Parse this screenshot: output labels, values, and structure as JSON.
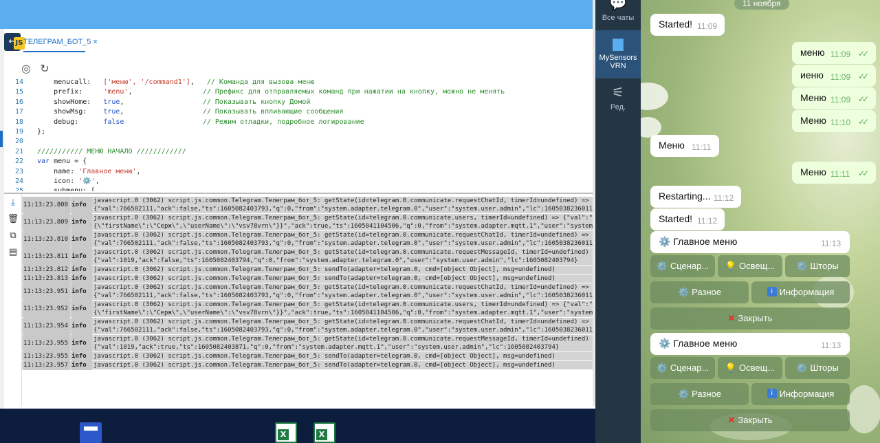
{
  "editor": {
    "tab_label": "ТЕЛЕГРАМ_БОТ_5",
    "tab_close": "×",
    "code": [
      {
        "n": "14",
        "parts": [
          [
            "",
            "    menucall:   "
          ],
          [
            "s",
            "['меню', '/command1']"
          ],
          [
            "",
            ",   "
          ],
          [
            "c",
            "// Команда для вызова меню"
          ]
        ]
      },
      {
        "n": "15",
        "parts": [
          [
            "",
            "    prefix:     "
          ],
          [
            "s",
            "'menu'"
          ],
          [
            "",
            ",                 "
          ],
          [
            "c",
            "// Префикс для отправляемых команд при нажатии на кнопку, можно не менять"
          ]
        ]
      },
      {
        "n": "16",
        "parts": [
          [
            "",
            "    showHome:   "
          ],
          [
            "k",
            "true"
          ],
          [
            "",
            ",                   "
          ],
          [
            "c",
            "// Показывать кнопку Домой"
          ]
        ]
      },
      {
        "n": "17",
        "parts": [
          [
            "",
            "    showMsg:    "
          ],
          [
            "k",
            "true"
          ],
          [
            "",
            ",                   "
          ],
          [
            "c",
            "// Показывать впливающие сообщения"
          ]
        ]
      },
      {
        "n": "18",
        "parts": [
          [
            "",
            "    debug:      "
          ],
          [
            "k",
            "false"
          ],
          [
            "",
            "                   "
          ],
          [
            "c",
            "// Режим отладки, подробное логирование"
          ]
        ]
      },
      {
        "n": "19",
        "parts": [
          [
            "",
            "};"
          ]
        ]
      },
      {
        "n": "20",
        "parts": [
          [
            "",
            ""
          ]
        ]
      },
      {
        "n": "21",
        "parts": [
          [
            "c",
            "/////////// МЕНЮ НАЧАЛО ////////////"
          ]
        ]
      },
      {
        "n": "22",
        "parts": [
          [
            "k",
            "var"
          ],
          [
            "",
            " menu = {"
          ]
        ]
      },
      {
        "n": "23",
        "parts": [
          [
            "",
            "    name: "
          ],
          [
            "s",
            "'Главное меню'"
          ],
          [
            "",
            ","
          ]
        ]
      },
      {
        "n": "24",
        "parts": [
          [
            "",
            "    icon: "
          ],
          [
            "s",
            "'⚙️'"
          ],
          [
            "",
            ","
          ]
        ]
      },
      {
        "n": "25",
        "parts": [
          [
            "",
            "    submenu: ["
          ]
        ]
      }
    ]
  },
  "log": {
    "rows": [
      {
        "time": "11:13:23.808",
        "level": "info",
        "lines": [
          "javascript.0 (3062) script.js.common.Telegram.Телеграм_бот_5: getState(id=telegram.0.communicate.requestChatId, timerId=undefined) =>",
          "{\"val\":766502111,\"ack\":false,\"ts\":1605082403793,\"q\":0,\"from\":\"system.adapter.telegram.0\",\"user\":\"system.user.admin\",\"lc\":1605038236011}"
        ]
      },
      {
        "time": "11:13:23.809",
        "level": "info",
        "lines": [
          "javascript.0 (3062) script.js.common.Telegram.Телеграм_бот_5: getState(id=telegram.0.communicate.users, timerId=undefined) => {\"val\":\"{\\",
          "{\\\"firstName\\\":\\\"Серж\\\",\\\"userName\\\":\\\"vsv78vrn\\\"}}\",\"ack\":true,\"ts\":1605041104506,\"q\":0,\"from\":\"system.adapter.mqtt.1\",\"user\":\"system.u"
        ]
      },
      {
        "time": "11:13:23.810",
        "level": "info",
        "lines": [
          "javascript.0 (3062) script.js.common.Telegram.Телеграм_бот_5: getState(id=telegram.0.communicate.requestChatId, timerId=undefined) =>",
          "{\"val\":766502111,\"ack\":false,\"ts\":1605082403793,\"q\":0,\"from\":\"system.adapter.telegram.0\",\"user\":\"system.user.admin\",\"lc\":1605038236011}"
        ]
      },
      {
        "time": "11:13:23.811",
        "level": "info",
        "lines": [
          "javascript.0 (3062) script.js.common.Telegram.Телеграм_бот_5: getState(id=telegram.0.communicate.requestMessageId, timerId=undefined) =>",
          "{\"val\":1019,\"ack\":false,\"ts\":1605082403794,\"q\":0,\"from\":\"system.adapter.telegram.0\",\"user\":\"system.user.admin\",\"lc\":1605082403794}"
        ]
      },
      {
        "time": "11:13:23.812",
        "level": "info",
        "lines": [
          "javascript.0 (3062) script.js.common.Telegram.Телеграм_бот_5: sendTo(adapter=telegram.0, cmd=[object Object], msg=undefined)"
        ]
      },
      {
        "time": "11:13:23.813",
        "level": "info",
        "lines": [
          "javascript.0 (3062) script.js.common.Telegram.Телеграм_бот_5: sendTo(adapter=telegram.0, cmd=[object Object], msg=undefined)"
        ]
      },
      {
        "time": "11:13:23.951",
        "level": "info",
        "lines": [
          "javascript.0 (3062) script.js.common.Telegram.Телеграм_бот_5: getState(id=telegram.0.communicate.requestChatId, timerId=undefined) =>",
          "{\"val\":766502111,\"ack\":false,\"ts\":1605082403793,\"q\":0,\"from\":\"system.adapter.telegram.0\",\"user\":\"system.user.admin\",\"lc\":1605038236011}"
        ]
      },
      {
        "time": "11:13:23.952",
        "level": "info",
        "lines": [
          "javascript.0 (3062) script.js.common.Telegram.Телеграм_бот_5: getState(id=telegram.0.communicate.users, timerId=undefined) => {\"val\":\"{\\",
          "{\\\"firstName\\\":\\\"Серж\\\",\\\"userName\\\":\\\"vsv78vrn\\\"}}\",\"ack\":true,\"ts\":1605041104506,\"q\":0,\"from\":\"system.adapter.mqtt.1\",\"user\":\"system.u"
        ]
      },
      {
        "time": "11:13:23.954",
        "level": "info",
        "lines": [
          "javascript.0 (3062) script.js.common.Telegram.Телеграм_бот_5: getState(id=telegram.0.communicate.requestChatId, timerId=undefined) =>",
          "{\"val\":766502111,\"ack\":false,\"ts\":1605082403793,\"q\":0,\"from\":\"system.adapter.telegram.0\",\"user\":\"system.user.admin\",\"lc\":1605038236011}"
        ]
      },
      {
        "time": "11:13:23.955",
        "level": "info",
        "lines": [
          "javascript.0 (3062) script.js.common.Telegram.Телеграм_бот_5: getState(id=telegram.0.communicate.requestMessageId, timerId=undefined) =>",
          "{\"val\":1019,\"ack\":true,\"ts\":1605082403871,\"q\":0,\"from\":\"system.adapter.mqtt.1\",\"user\":\"system.user.admin\",\"lc\":1605082403794}"
        ]
      },
      {
        "time": "11:13:23.955",
        "level": "info",
        "lines": [
          "javascript.0 (3062) script.js.common.Telegram.Телеграм_бот_5: sendTo(adapter=telegram.0, cmd=[object Object], msg=undefined)"
        ]
      },
      {
        "time": "11:13:23.957",
        "level": "info",
        "lines": [
          "javascript.0 (3062) script.js.common.Telegram.Телеграм_бот_5: sendTo(adapter=telegram.0, cmd=[object Object], msg=undefined)"
        ]
      }
    ]
  },
  "telegram": {
    "nav": [
      {
        "label": "Все чаты",
        "icon": "chat-bubbles-icon"
      },
      {
        "label": "MySensors VRN",
        "icon": "folder-icon"
      },
      {
        "label": "Ред.",
        "icon": "sliders-icon"
      }
    ],
    "date": "11 ноября",
    "messages": [
      {
        "dir": "in",
        "text": "Started!",
        "time": "11:09"
      },
      {
        "dir": "out",
        "text": "меню",
        "time": "11:09"
      },
      {
        "dir": "out",
        "text": "иеню",
        "time": "11:09"
      },
      {
        "dir": "out",
        "text": "Меню",
        "time": "11:09"
      },
      {
        "dir": "out",
        "text": "Меню",
        "time": "11:10"
      },
      {
        "dir": "in",
        "text": "Меню",
        "time": "11:11"
      },
      {
        "dir": "out",
        "text": "Меню",
        "time": "11:11"
      },
      {
        "dir": "in",
        "text": "Restarting...",
        "time": "11:12"
      },
      {
        "dir": "in",
        "text": "Started!",
        "time": "11:12"
      },
      {
        "dir": "in",
        "text": "Главное меню",
        "time": "11:13",
        "gear": "⚙️"
      },
      {
        "dir": "in",
        "text": "Главное меню",
        "time": "11:13",
        "gear": "⚙️"
      }
    ],
    "keyboard": {
      "row1": [
        {
          "icon": "⚙️",
          "label": "Сценар..."
        },
        {
          "icon": "💡",
          "label": "Освещ..."
        },
        {
          "icon": "⚙️",
          "label": "Шторы"
        }
      ],
      "row2": [
        {
          "icon": "⚙️",
          "label": "Разное"
        },
        {
          "icon": "i",
          "label": "Информация"
        }
      ],
      "row3": [
        {
          "icon": "✕",
          "label": "Закрыть"
        }
      ]
    }
  }
}
